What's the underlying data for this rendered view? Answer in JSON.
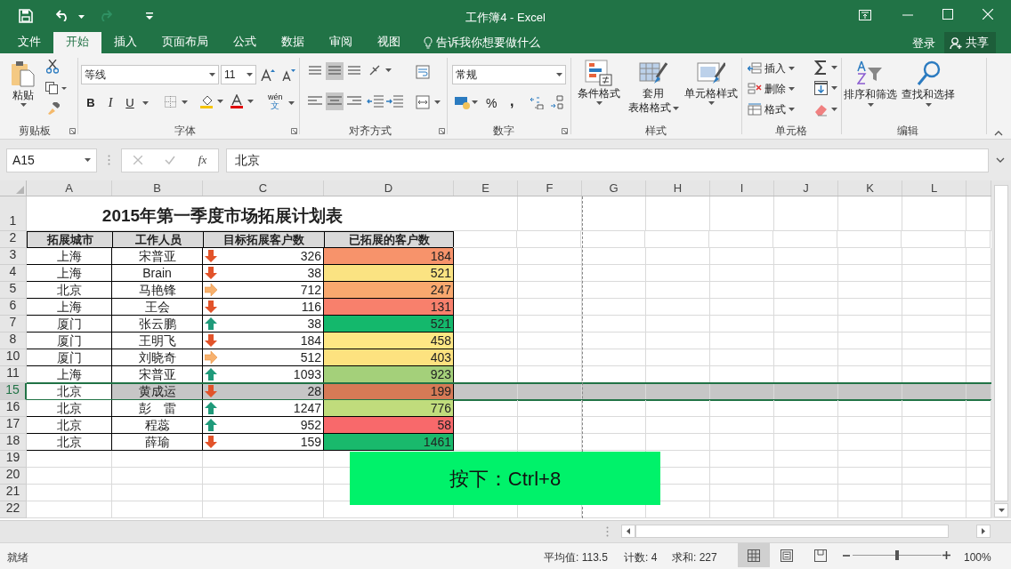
{
  "window": {
    "title": "工作簿4 - Excel"
  },
  "tabs": [
    {
      "label": "文件",
      "selected": false
    },
    {
      "label": "开始",
      "selected": true
    },
    {
      "label": "插入",
      "selected": false
    },
    {
      "label": "页面布局",
      "selected": false
    },
    {
      "label": "公式",
      "selected": false
    },
    {
      "label": "数据",
      "selected": false
    },
    {
      "label": "审阅",
      "selected": false
    },
    {
      "label": "视图",
      "selected": false
    }
  ],
  "tell_me": "告诉我你想要做什么",
  "sign_in": "登录",
  "share": "共享",
  "ribbon": {
    "clipboard": {
      "label": "剪贴板",
      "paste": "粘贴"
    },
    "font": {
      "label": "字体",
      "font_name": "等线",
      "font_size": "11",
      "bold": "B",
      "italic": "I",
      "underline": "U",
      "phonetic": [
        "wén",
        "文"
      ]
    },
    "alignment": {
      "label": "对齐方式"
    },
    "number": {
      "label": "数字",
      "format": "常规",
      "percent": "%",
      "comma": ","
    },
    "styles": {
      "label": "样式",
      "buttons": [
        {
          "lines": [
            "条件格式"
          ]
        },
        {
          "lines": [
            "套用",
            "表格格式"
          ]
        },
        {
          "lines": [
            "单元格样式"
          ]
        }
      ]
    },
    "cells": {
      "label": "单元格",
      "buttons": [
        "插入",
        "删除",
        "格式"
      ]
    },
    "editing": {
      "label": "编辑",
      "buttons": [
        "排序和筛选",
        "查找和选择"
      ]
    }
  },
  "formula_bar": {
    "name_box": "A15",
    "fx": "fx",
    "value": "北京"
  },
  "sheet": {
    "columns": [
      "A",
      "B",
      "C",
      "D",
      "E",
      "F",
      "G",
      "H",
      "I",
      "J",
      "K",
      "L"
    ],
    "title_row": "1",
    "title": "2015年第一季度市场拓展计划表",
    "header_row": "2",
    "headers": [
      "拓展城市",
      "工作人员",
      "目标拓展客户数",
      "已拓展的客户数"
    ],
    "rows": [
      {
        "row": "3",
        "city": "上海",
        "person": "宋普亚",
        "kind": "down",
        "target": "326",
        "done": "184",
        "color": "#f7936b",
        "selected": false
      },
      {
        "row": "4",
        "city": "上海",
        "person": "Brain",
        "kind": "down",
        "target": "38",
        "done": "521",
        "color": "#fbe382",
        "selected": false
      },
      {
        "row": "5",
        "city": "北京",
        "person": "马艳锋",
        "kind": "right",
        "target": "712",
        "done": "247",
        "color": "#f9a86e",
        "selected": false
      },
      {
        "row": "6",
        "city": "上海",
        "person": "王会",
        "kind": "down",
        "target": "116",
        "done": "131",
        "color": "#f8806c",
        "selected": false
      },
      {
        "row": "7",
        "city": "厦门",
        "person": "张云鹏",
        "kind": "up",
        "target": "38",
        "done": "521",
        "color": "#14b86c",
        "selected": false
      },
      {
        "row": "8",
        "city": "厦门",
        "person": "王明飞",
        "kind": "down",
        "target": "184",
        "done": "458",
        "color": "#fee784",
        "selected": false
      },
      {
        "row": "10",
        "city": "厦门",
        "person": "刘晓奇",
        "kind": "right",
        "target": "512",
        "done": "403",
        "color": "#fde27f",
        "selected": false
      },
      {
        "row": "11",
        "city": "上海",
        "person": "宋普亚",
        "kind": "up",
        "target": "1093",
        "done": "923",
        "color": "#a4d07a",
        "selected": false
      },
      {
        "row": "15",
        "city": "北京",
        "person": "黄成运",
        "kind": "down",
        "target": "28",
        "done": "199",
        "color": "#d67a56",
        "selected": true
      },
      {
        "row": "16",
        "city": "北京",
        "person": "彭　雷",
        "kind": "up",
        "target": "1247",
        "done": "776",
        "color": "#c0dc7c",
        "selected": false
      },
      {
        "row": "17",
        "city": "北京",
        "person": "程蕊",
        "kind": "up",
        "target": "952",
        "done": "58",
        "color": "#f8696b",
        "selected": false
      },
      {
        "row": "18",
        "city": "北京",
        "person": "薛瑜",
        "kind": "down",
        "target": "159",
        "done": "1461",
        "color": "#19b96c",
        "selected": false
      }
    ],
    "empty_rows": [
      "19",
      "20",
      "21",
      "22"
    ]
  },
  "overlay": "按下：Ctrl+8",
  "status_bar": {
    "ready": "就绪",
    "average": "平均值: 113.5",
    "count": "计数: 4",
    "sum": "求和: 227",
    "zoom": "100%",
    "level": 0.5,
    "views": [
      {
        "selected": true
      },
      {
        "selected": false
      },
      {
        "selected": false
      }
    ]
  }
}
